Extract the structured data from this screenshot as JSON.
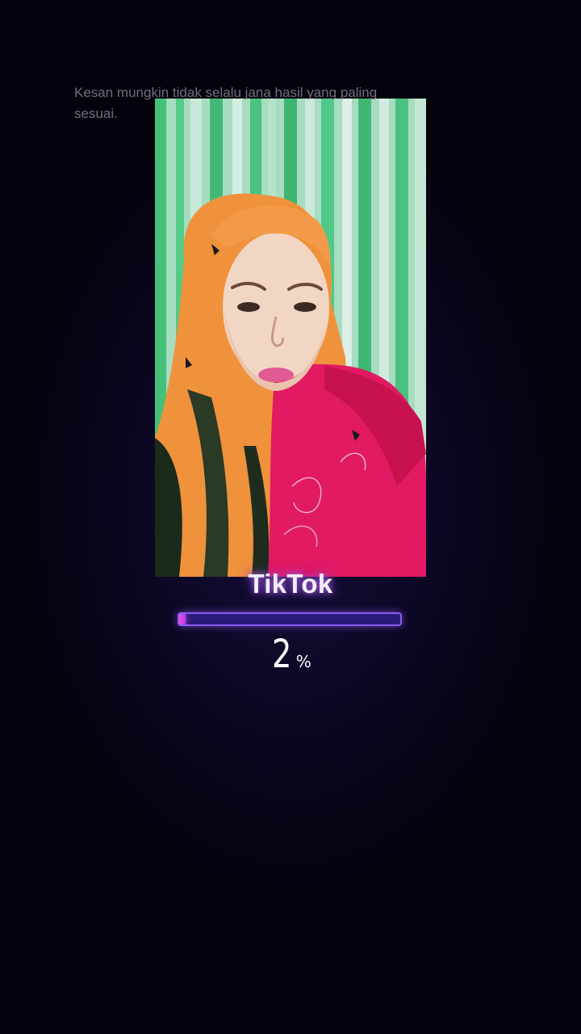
{
  "disclaimer": {
    "text": "Kesan mungkin tidak selalu jana hasil yang paling sesuai."
  },
  "preview": {
    "image": "woman-in-orange-and-pink-hijab-photo"
  },
  "brand": {
    "name": "TikTok",
    "glow_color": "#b36ce8"
  },
  "progress": {
    "value_percent": 2,
    "number": "2",
    "unit": "%",
    "track_color": "#2a1a7a",
    "fill_color": "#ff4fd8"
  }
}
